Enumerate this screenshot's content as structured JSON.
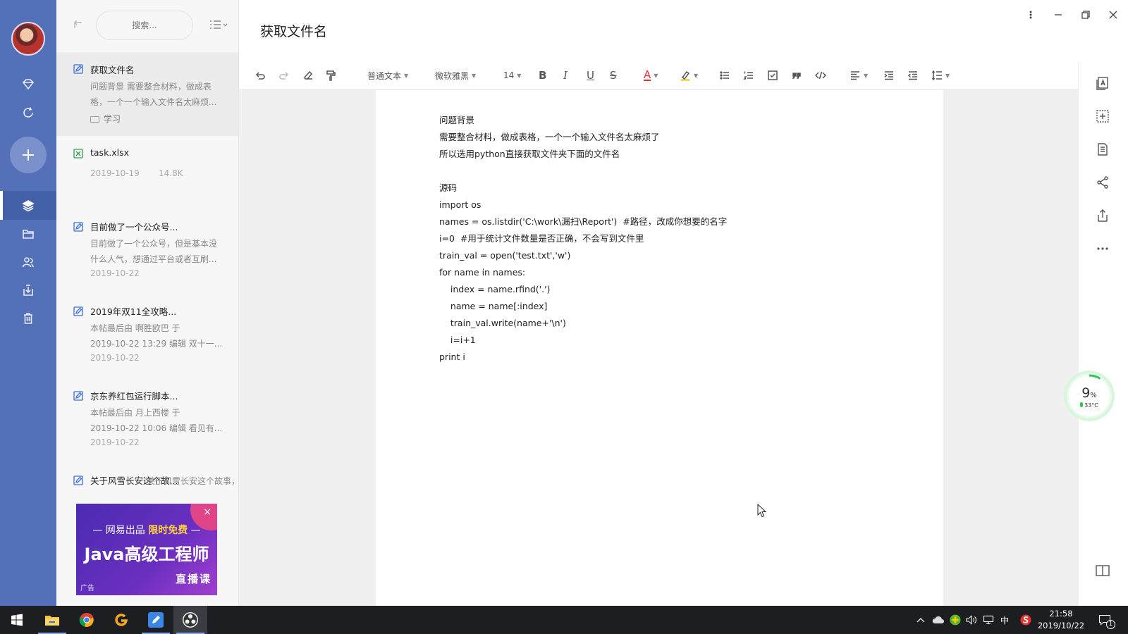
{
  "sidebar_list": {
    "search_placeholder": "搜索..."
  },
  "notes": [
    {
      "title": "获取文件名",
      "lines": [
        "问题背景 需要整合材料，做成表",
        "格，一个一个输入文件名太麻烦..."
      ],
      "folder": "学习",
      "date": ""
    },
    {
      "title": "task.xlsx",
      "lines": [],
      "date": "2019-10-19",
      "size": "14.8K"
    },
    {
      "title": "目前做了一个公众号...",
      "lines": [
        "目前做了一个公众号，但是基本没",
        "什么人气，想通过平台或者互刷..."
      ],
      "date": "2019-10-22"
    },
    {
      "title": "2019年双11全攻略...",
      "lines": [
        "本帖最后由 啊胜欧巴 于",
        "2019-10-22 13:29 编辑 双十一..."
      ],
      "date": "2019-10-22"
    },
    {
      "title": "京东养红包运行脚本...",
      "lines": [
        "本帖最后由 月上西楼 于",
        "2019-10-22 10:06 编辑 看见有..."
      ],
      "date": "2019-10-22"
    },
    {
      "title": "关于风雪长安这个故...",
      "lines": [
        "关于风雪长安这个故事，大概是受"
      ],
      "date": ""
    }
  ],
  "ad": {
    "line1_a": "— 网易出品 ",
    "line1_hl": "限时免费",
    "line1_b": " —",
    "line2": "Java高级工程师",
    "line3": "直播课",
    "tag": "广告",
    "close": "×"
  },
  "document": {
    "title": "获取文件名",
    "content": "问题背景\n需要整合材料，做成表格，一个一个输入文件名太麻烦了\n所以选用python直接获取文件夹下面的文件名\n\n源码\nimport os\nnames = os.listdir('C:\\work\\漏扫\\Report')  #路径，改成你想要的名字\ni=0  #用于统计文件数量是否正确，不会写到文件里\ntrain_val = open('test.txt','w')\nfor name in names:\n    index = name.rfind('.')\n    name = name[:index]\n    train_val.write(name+'\\n')\n    i=i+1\nprint i"
  },
  "toolbar": {
    "style_select": "普通文本",
    "font_select": "微软雅黑",
    "size_select": "14",
    "bold": "B",
    "italic": "I",
    "underline": "U",
    "strike": "S",
    "font_color": "A"
  },
  "perf_widget": {
    "percent": "9",
    "percent_unit": "%",
    "temp": "33°C",
    "ring_color": "#35c45a"
  },
  "taskbar": {
    "time": "21:58",
    "date": "2019/10/22",
    "ime": "中",
    "notif_count": "1"
  },
  "colors": {
    "rail": "#5470b8",
    "accent_icon": "#3a6fd8",
    "excel_icon": "#2e9e4d"
  }
}
